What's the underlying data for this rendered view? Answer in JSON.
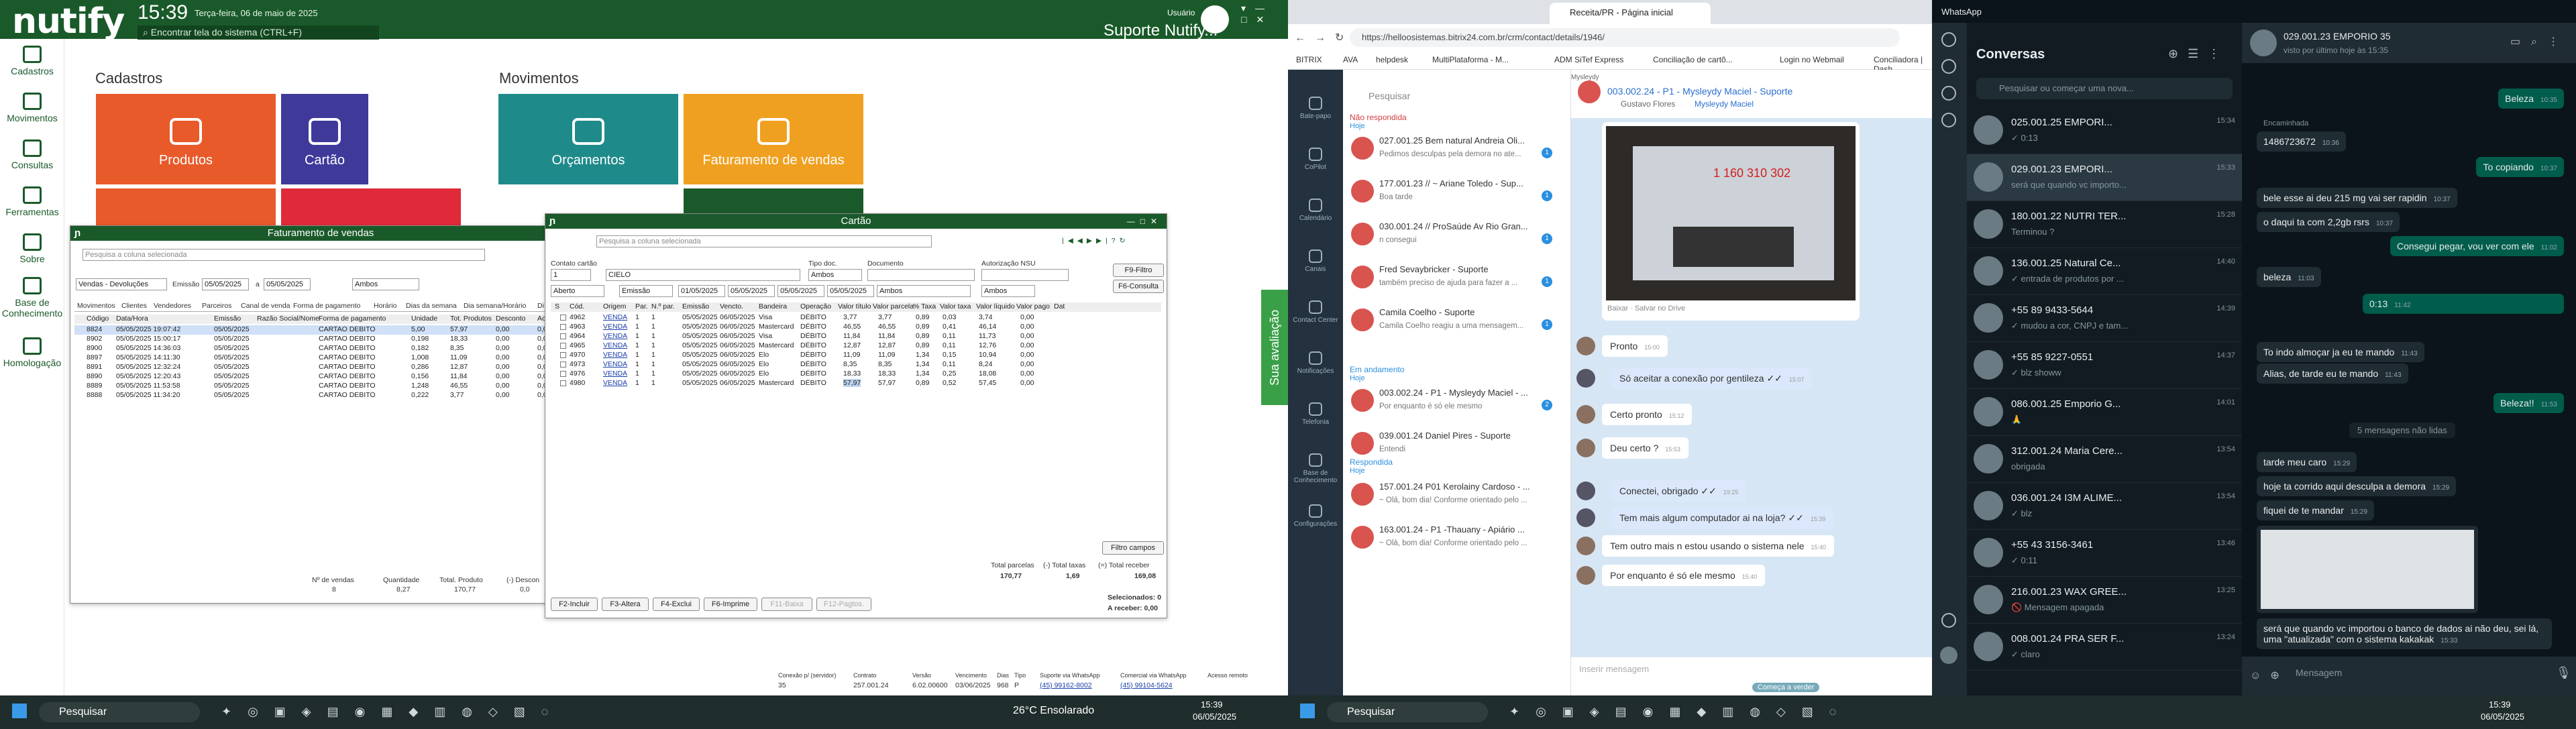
{
  "nutify": {
    "brand": "nutify",
    "clock": "15:39",
    "date": "Terça-feira, 06 de maio de 2025",
    "hint": "Encontrar tela do sistema (CTRL+F)",
    "user_label": "Usuário",
    "user_name": "Suporte Nutify...",
    "nav": [
      "Cadastros",
      "Movimentos",
      "Consultas",
      "Ferramentas",
      "Sobre",
      "Base de Conhecimento",
      "Homologação"
    ],
    "sections": {
      "cadastros": "Cadastros",
      "movimentos": "Movimentos"
    },
    "tiles": [
      "Produtos",
      "Cartão",
      "Orçamentos",
      "Faturamento de vendas"
    ],
    "fat": {
      "title": "Faturamento de vendas",
      "search_placeholder": "Pesquisa a coluna selecionada",
      "filter_type": "Vendas - Devoluções",
      "emissao_label": "Emissão",
      "date_from": "05/05/2025",
      "date_to": "05/05/2025",
      "a": "a",
      "ambos": "Ambos",
      "tabs": [
        "Movimentos",
        "Clientes",
        "Vendedores",
        "Parceiros",
        "Canal de venda",
        "Forma de pagamento",
        "Horário",
        "Dias da semana",
        "Dia semana/Horário",
        "Di"
      ],
      "cols": [
        "Código",
        "Data/Hora",
        "Emissão",
        "Razão Social/Nome",
        "Forma de pagamento",
        "Unidade",
        "Tot. Produtos",
        "Desconto",
        "Acré"
      ],
      "rows": [
        [
          "8824",
          "05/05/2025 19:07:42",
          "05/05/2025",
          "",
          "CARTAO DEBITO",
          "5,00",
          "57,97",
          "0,00",
          "0,00"
        ],
        [
          "8902",
          "05/05/2025 15:00:17",
          "05/05/2025",
          "",
          "CARTAO DEBITO",
          "0,198",
          "18,33",
          "0,00",
          "0,00"
        ],
        [
          "8900",
          "05/05/2025 14:36:03",
          "05/05/2025",
          "",
          "CARTAO DEBITO",
          "0,182",
          "8,35",
          "0,00",
          "0,00"
        ],
        [
          "8897",
          "05/05/2025 14:11:30",
          "05/05/2025",
          "",
          "CARTAO DEBITO",
          "1,008",
          "11,09",
          "0,00",
          "0,00"
        ],
        [
          "8891",
          "05/05/2025 12:32:24",
          "05/05/2025",
          "",
          "CARTAO DEBITO",
          "0,286",
          "12,87",
          "0,00",
          "0,00"
        ],
        [
          "8890",
          "05/05/2025 12:20:43",
          "05/05/2025",
          "",
          "CARTAO DEBITO",
          "0,156",
          "11,84",
          "0,00",
          "0,00"
        ],
        [
          "8889",
          "05/05/2025 11:53:58",
          "05/05/2025",
          "",
          "CARTAO DEBITO",
          "1,248",
          "46,55",
          "0,00",
          "0,00"
        ],
        [
          "8888",
          "05/05/2025 11:34:20",
          "05/05/2025",
          "",
          "CARTAO DEBITO",
          "0,222",
          "3,77",
          "0,00",
          "0,00"
        ]
      ],
      "footer": {
        "n_vendas_label": "Nº de vendas",
        "n_vendas": "8",
        "qtd_label": "Quantidade",
        "qtd": "8,27",
        "tp_label": "Total. Produto",
        "tp": "170,77",
        "desc_label": "(-) Descon",
        "desc": "0,0"
      }
    },
    "cartao": {
      "title": "Cartão",
      "search_placeholder": "Pesquisa a coluna selecionada",
      "contato_label": "Contato cartão",
      "contato_val": "1",
      "contato_name": "CIELO",
      "tipo_doc_label": "Tipo doc.",
      "tipo_doc_val": "Ambos",
      "documento_label": "Documento",
      "nsu_label": "Autorização NSU",
      "btn_filtro": "F9-Filtro",
      "btn_consulta": "F6-Consulta",
      "aberto": "Aberto",
      "emissao": "Emissão",
      "d1": "01/05/2025",
      "d2": "05/05/2025",
      "d3": "05/05/2025",
      "d4": "05/05/2025",
      "ambos": "Ambos",
      "cols": [
        "S",
        "Cód.",
        "Origem",
        "Par.",
        "N.º par.",
        "Emissão",
        "Vencto.",
        "Bandeira",
        "Operação",
        "Valor título",
        "Valor parcela",
        "% Taxa",
        "Valor taxa",
        "Valor líquido",
        "Valor pago",
        "Dat"
      ],
      "rows": [
        [
          "",
          "4962",
          "VENDA",
          "1",
          "1",
          "05/05/2025",
          "06/05/2025",
          "Visa",
          "DÉBITO",
          "3,77",
          "3,77",
          "0,89",
          "0,03",
          "3,74",
          "0,00"
        ],
        [
          "",
          "4963",
          "VENDA",
          "1",
          "1",
          "05/05/2025",
          "06/05/2025",
          "Mastercard",
          "DÉBITO",
          "46,55",
          "46,55",
          "0,89",
          "0,41",
          "46,14",
          "0,00"
        ],
        [
          "",
          "4964",
          "VENDA",
          "1",
          "1",
          "05/05/2025",
          "06/05/2025",
          "Visa",
          "DÉBITO",
          "11,84",
          "11,84",
          "0,89",
          "0,11",
          "11,73",
          "0,00"
        ],
        [
          "",
          "4965",
          "VENDA",
          "1",
          "1",
          "05/05/2025",
          "06/05/2025",
          "Mastercard",
          "DÉBITO",
          "12,87",
          "12,87",
          "0,89",
          "0,11",
          "12,76",
          "0,00"
        ],
        [
          "",
          "4970",
          "VENDA",
          "1",
          "1",
          "05/05/2025",
          "06/05/2025",
          "Elo",
          "DÉBITO",
          "11,09",
          "11,09",
          "1,34",
          "0,15",
          "10,94",
          "0,00"
        ],
        [
          "",
          "4973",
          "VENDA",
          "1",
          "1",
          "05/05/2025",
          "06/05/2025",
          "Elo",
          "DÉBITO",
          "8,35",
          "8,35",
          "1,34",
          "0,11",
          "8,24",
          "0,00"
        ],
        [
          "",
          "4976",
          "VENDA",
          "1",
          "1",
          "05/05/2025",
          "06/05/2025",
          "Elo",
          "DÉBITO",
          "18,33",
          "18,33",
          "1,34",
          "0,25",
          "18,08",
          "0,00"
        ],
        [
          "",
          "4980",
          "VENDA",
          "1",
          "1",
          "05/05/2025",
          "06/05/2025",
          "Mastercard",
          "DÉBITO",
          "57,97",
          "57,97",
          "0,89",
          "0,52",
          "57,45",
          "0,00"
        ]
      ],
      "filtro_campos": "Filtro campos",
      "tot_parcelas_label": "Total parcelas",
      "tot_parcelas": "170,77",
      "tot_taxas_label": "(-) Total taxas",
      "tot_taxas": "1,69",
      "receber_label": "(=) Total receber",
      "receber": "169,08",
      "selecionados": "Selecionados: 0",
      "a_receber": "A receber: 0,00",
      "btns": [
        "F2-Incluir",
        "F3-Altera",
        "F4-Exclui",
        "F6-Imprime",
        "F11-Baixa",
        "F12-Pagtos."
      ]
    },
    "status": {
      "conexao": "Conexão p/ (servidor)",
      "conexao_v": "35",
      "contrato": "Contrato",
      "contrato_v": "257.001.24",
      "versao": "Versão",
      "versao_v": "6.02.00600",
      "venc": "Vencimento",
      "venc_v": "03/06/2025",
      "dias": "Dias",
      "dias_v": "968",
      "tipo": "Tipo",
      "tipo_v": "P",
      "suporte": "Suporte via WhatsApp",
      "suporte_v": "(45) 99162-8002",
      "comercial": "Comercial via WhatsApp",
      "comercial_v": "(45) 99104-5624",
      "acesso": "Acesso remoto"
    },
    "side_tab": "Sua avaliação"
  },
  "chrome": {
    "tab": "Receita/PR - Página inicial",
    "url": "https://helloosistemas.bitrix24.com.br/crm/contact/details/1946/",
    "bookmarks": [
      "BITRIX",
      "AVA",
      "helpdesk",
      "MultiPlataforma - M...",
      "ADM SiTef Express",
      "Conciliação de cartõ...",
      "Login no Webmail",
      "Conciliadora | Dash..."
    ],
    "bx_nav": [
      "Bate-papo",
      "CoPilot",
      "Calendário",
      "Canais",
      "Contact Center",
      "Notificações",
      "Telefonia",
      "Base de Conhecimento",
      "Configurações"
    ],
    "search": "Pesquisar",
    "nao_resp": "Não respondida",
    "hoje": "Hoje",
    "em_andamento": "Em andamento",
    "respondida": "Respondida",
    "chats_a": [
      {
        "n": "027.001.25 Bem natural Andreia Oli...",
        "p": "Pedimos desculpas pela demora no ate...",
        "c": "1"
      },
      {
        "n": "177.001.23 // ~ Ariane Toledo - Sup...",
        "p": "Boa tarde",
        "c": "1"
      },
      {
        "n": "030.001.24 // ProSaúde Av Rio Gran...",
        "p": "n consegui",
        "c": "1"
      },
      {
        "n": "Fred Sevaybricker - Suporte",
        "p": "também preciso de ajuda para fazer a ...",
        "c": "1"
      },
      {
        "n": "Camila Coelho - Suporte",
        "p": "Camila Coelho reagiu a uma mensagem...",
        "c": "1"
      }
    ],
    "chats_b": [
      {
        "n": "003.002.24 - P1 - Mysleydy Maciel - ...",
        "p": "Por enquanto é só ele mesmo",
        "c": "2"
      },
      {
        "n": "039.001.24 Daniel Pires - Suporte",
        "p": "Entendi",
        "c": ""
      }
    ],
    "chats_c": [
      {
        "n": "157.001.24 P01 Kerolainy Cardoso - ...",
        "p": "~ Olá, bom dia! Conforme orientado pelo ...",
        "c": ""
      },
      {
        "n": "163.001.24 - P1 -Thauany - Apiário ...",
        "p": "~ Olá, bom dia! Conforme orientado pelo ...",
        "c": ""
      }
    ],
    "chat_title": "003.002.24 - P1 - Mysleydy Maciel - Suporte",
    "chat_sub1": "Gustavo Flores",
    "chat_sub2": "Mysleydy Maciel",
    "img_num": "1 160 310 302",
    "img_caption": "Baixar · Salvar no Drive",
    "msgs": [
      {
        "s": "Pronto",
        "t": "15:00",
        "side": "in"
      },
      {
        "s": "Só aceitar a conexão por gentileza ✓✓",
        "t": "15:07",
        "side": "out"
      },
      {
        "s": "Certo pronto",
        "t": "15:12",
        "side": "in"
      },
      {
        "s": "Deu certo ?",
        "t": "15:53",
        "side": "in"
      },
      {
        "s": "Conectei, obrigado ✓✓",
        "t": "19:25",
        "side": "out"
      },
      {
        "s": "Tem mais algum computador ai na loja? ✓✓",
        "t": "15:39",
        "side": "out"
      },
      {
        "s": "Tem outro mais n estou usando o sistema nele",
        "t": "15:40",
        "side": "in"
      },
      {
        "s": "Por enquanto é só ele mesmo",
        "t": "15:40",
        "side": "in"
      }
    ],
    "name_mysleydy": "Mysleydy",
    "name_gustavo": "Gustavo",
    "input_placeholder": "Inserir mensagem",
    "btn_verde": "Começa a verder"
  },
  "whatsapp": {
    "app": "WhatsApp",
    "title": "Conversas",
    "search_placeholder": "Pesquisar ou começar uma nova...",
    "chats": [
      {
        "n": "025.001.25 EMPORI...",
        "p": "✓ 0:13",
        "t": "15:34"
      },
      {
        "n": "029.001.23 EMPORI...",
        "p": "será que quando vc importo...",
        "t": "15:33"
      },
      {
        "n": "180.001.22 NUTRI TER...",
        "p": "Terminou ?",
        "t": "15:28"
      },
      {
        "n": "136.001.25 Natural Ce...",
        "p": "✓ entrada de produtos por ...",
        "t": "14:40"
      },
      {
        "n": "+55 89 9433-5644",
        "p": "✓ mudou a cor, CNPJ e tam...",
        "t": "14:39"
      },
      {
        "n": "+55 85 9227-0551",
        "p": "✓ blz showw",
        "t": "14:37"
      },
      {
        "n": "086.001.25 Emporio G...",
        "p": "🙏",
        "t": "14:01"
      },
      {
        "n": "312.001.24 Maria Cere...",
        "p": "obrigada",
        "t": "13:54"
      },
      {
        "n": "036.001.24 I3M ALIME...",
        "p": "✓ blz",
        "t": "13:54"
      },
      {
        "n": "+55 43 3156-3461",
        "p": "✓ 0:11",
        "t": "13:46"
      },
      {
        "n": "216.001.23 WAX GREE...",
        "p": "🚫 Mensagem apagada",
        "t": "13:25"
      },
      {
        "n": "008.001.24 PRA SER F...",
        "p": "✓ claro",
        "t": "13:24"
      }
    ],
    "chat_name": "029.001.23 EMPORIO 35",
    "chat_status": "visto por último hoje às 15:35",
    "msgs": [
      {
        "s": "Beleza",
        "t": "10:35",
        "side": "out"
      },
      {
        "s": "Encaminhada",
        "t": "",
        "side": "in"
      },
      {
        "s": "1486723672",
        "t": "10:36",
        "side": "in"
      },
      {
        "s": "To copiando",
        "t": "10:37",
        "side": "out"
      },
      {
        "s": "bele esse ai deu 215 mg vai ser rapidin",
        "t": "10:37",
        "side": "in"
      },
      {
        "s": "o daqui ta com 2,2gb rsrs",
        "t": "10:37",
        "side": "in"
      },
      {
        "s": "Consegui pegar, vou ver com ele",
        "t": "11:02",
        "side": "out"
      },
      {
        "s": "beleza",
        "t": "11:03",
        "side": "in"
      },
      {
        "s": "0:13",
        "t": "11:42",
        "side": "out"
      },
      {
        "s": "To indo almoçar ja eu te mando",
        "t": "11:43",
        "side": "in"
      },
      {
        "s": "Alias, de tarde eu te mando",
        "t": "11:43",
        "side": "in"
      },
      {
        "s": "Beleza!!",
        "t": "11:53",
        "side": "out"
      },
      {
        "s": "5 mensagens não lidas",
        "t": "",
        "side": "sys"
      },
      {
        "s": "tarde meu caro",
        "t": "15:29",
        "side": "in"
      },
      {
        "s": "hoje ta corrido aqui desculpa a demora",
        "t": "15:29",
        "side": "in"
      },
      {
        "s": "fiquei de te mandar",
        "t": "15:29",
        "side": "in"
      },
      {
        "s": "será que quando vc importou o banco de dados ai não deu, sei lá, uma \"atualizada\" com o sistema kakakak",
        "t": "15:33",
        "side": "in"
      }
    ],
    "input_placeholder": "Mensagem"
  },
  "taskbar": {
    "search": "Pesquisar",
    "weather": "26°C Ensolarado",
    "time": "15:39",
    "date": "06/05/2025"
  }
}
